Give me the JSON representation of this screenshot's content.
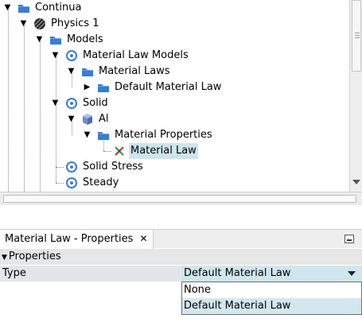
{
  "tree": {
    "nodes": [
      {
        "label": "Continua",
        "icon": "folder-icon",
        "toggle": "expanded"
      },
      {
        "label": "Physics 1",
        "icon": "physics-continuum-icon",
        "toggle": "expanded"
      },
      {
        "label": "Models",
        "icon": "folder-icon",
        "toggle": "expanded"
      },
      {
        "label": "Material Law Models",
        "icon": "model-icon",
        "toggle": "expanded"
      },
      {
        "label": "Material Laws",
        "icon": "folder-icon",
        "toggle": "expanded"
      },
      {
        "label": "Default Material Law",
        "icon": "folder-icon",
        "toggle": "collapsed"
      },
      {
        "label": "Solid",
        "icon": "model-icon",
        "toggle": "expanded"
      },
      {
        "label": "Al",
        "icon": "material-cube-icon",
        "toggle": "expanded"
      },
      {
        "label": "Material Properties",
        "icon": "folder-icon",
        "toggle": "expanded"
      },
      {
        "label": "Material Law",
        "icon": "material-law-icon",
        "toggle": "none",
        "selected": true
      },
      {
        "label": "Solid Stress",
        "icon": "model-icon",
        "toggle": "none"
      },
      {
        "label": "Steady",
        "icon": "model-icon",
        "toggle": "none"
      }
    ]
  },
  "properties_panel": {
    "tab_title": "Material Law - Properties",
    "close_glyph": "✕",
    "section_title": "Properties",
    "type_label": "Type",
    "type_value": "Default Material Law",
    "dropdown_options": [
      "None",
      "Default Material Law"
    ],
    "dropdown_selected": "Default Material Law"
  },
  "colors": {
    "folder": "#3a7bd5",
    "selection": "#cde5ec",
    "section_bg": "#e6e6e6"
  }
}
